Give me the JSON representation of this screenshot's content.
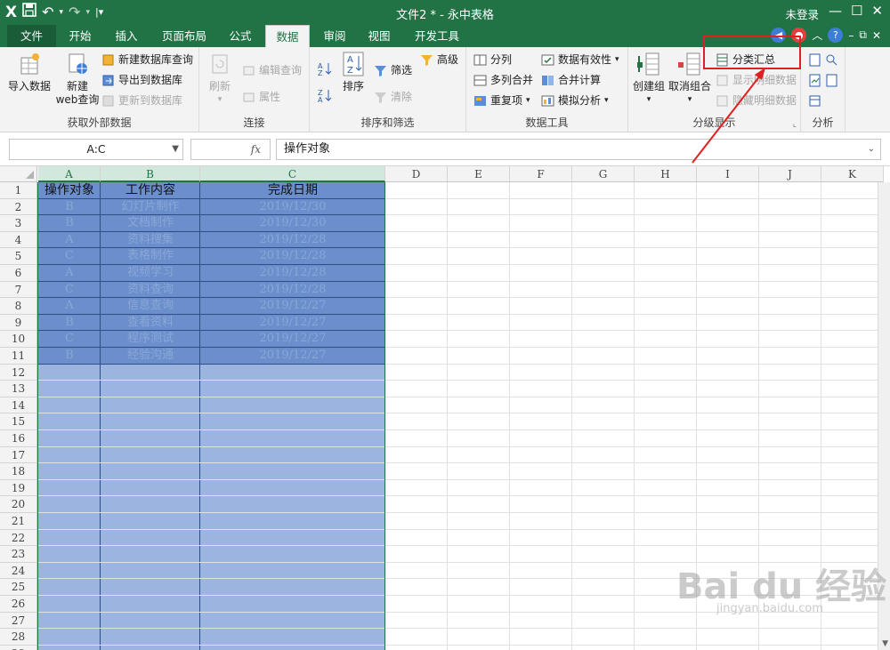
{
  "app": {
    "logo": "X",
    "title": "文件2 * - 永中表格",
    "login": "未登录"
  },
  "tabs": [
    "文件",
    "开始",
    "插入",
    "页面布局",
    "公式",
    "数据",
    "审阅",
    "视图",
    "开发工具"
  ],
  "active_tab": "数据",
  "ribbon": {
    "groups": {
      "external": "获取外部数据",
      "connect": "连接",
      "sort_filter": "排序和筛选",
      "data_tools": "数据工具",
      "outline": "分级显示",
      "analysis": "分析"
    },
    "import_data": "导入数据",
    "new_web_query_line1": "新建",
    "new_web_query_line2": "web查询",
    "new_db_query": "新建数据库查询",
    "export_db": "导出到数据库",
    "update_db": "更新到数据库",
    "refresh": "刷新",
    "edit_query": "编辑查询",
    "properties": "属性",
    "sort": "排序",
    "filter": "筛选",
    "advanced": "高级",
    "clear": "清除",
    "split": "分列",
    "multi_merge": "多列合并",
    "duplicates": "重复项",
    "validity": "数据有效性",
    "consolidate": "合并计算",
    "simulate": "模拟分析",
    "create_group": "创建组",
    "ungroup": "取消组合",
    "subtotal": "分类汇总",
    "show_detail": "显示明细数据",
    "hide_detail": "隐藏明细数据"
  },
  "formula_bar": {
    "name_box": "A:C",
    "fx": "fx",
    "content": "操作对象"
  },
  "columns": [
    "A",
    "B",
    "C",
    "D",
    "E",
    "F",
    "G",
    "H",
    "I",
    "J",
    "K"
  ],
  "rows": [
    "1",
    "2",
    "3",
    "4",
    "5",
    "6",
    "7",
    "8",
    "9",
    "10",
    "11",
    "12",
    "13",
    "14",
    "15",
    "16",
    "17",
    "18",
    "19",
    "20",
    "21",
    "22",
    "23",
    "24",
    "25",
    "26",
    "27",
    "28",
    "29"
  ],
  "table": {
    "headers": [
      "操作对象",
      "工作内容",
      "完成日期"
    ],
    "data": [
      [
        "B",
        "幻灯片制作",
        "2019/12/30"
      ],
      [
        "B",
        "文档制作",
        "2019/12/30"
      ],
      [
        "A",
        "资料搜集",
        "2019/12/28"
      ],
      [
        "C",
        "表格制作",
        "2019/12/28"
      ],
      [
        "A",
        "视频学习",
        "2019/12/28"
      ],
      [
        "C",
        "资料查询",
        "2019/12/28"
      ],
      [
        "A",
        "信息查询",
        "2019/12/27"
      ],
      [
        "B",
        "查看资料",
        "2019/12/27"
      ],
      [
        "C",
        "程序测试",
        "2019/12/27"
      ],
      [
        "B",
        "经验沟通",
        "2019/12/27"
      ]
    ]
  },
  "watermark": {
    "brand": "Bai du 经验",
    "url": "jingyan.baidu.com"
  },
  "colors": {
    "accent": "#217346",
    "selection": "#9bb5e0",
    "data_fill": "#6a8fcc",
    "callout": "#e02020"
  }
}
